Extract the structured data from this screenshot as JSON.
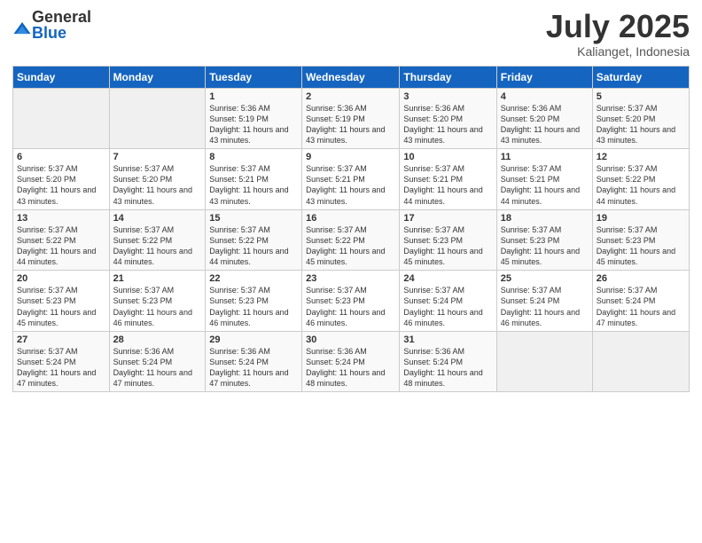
{
  "logo": {
    "general": "General",
    "blue": "Blue"
  },
  "title": "July 2025",
  "location": "Kalianget, Indonesia",
  "headers": [
    "Sunday",
    "Monday",
    "Tuesday",
    "Wednesday",
    "Thursday",
    "Friday",
    "Saturday"
  ],
  "weeks": [
    [
      {
        "day": "",
        "info": ""
      },
      {
        "day": "",
        "info": ""
      },
      {
        "day": "1",
        "info": "Sunrise: 5:36 AM\nSunset: 5:19 PM\nDaylight: 11 hours and 43 minutes."
      },
      {
        "day": "2",
        "info": "Sunrise: 5:36 AM\nSunset: 5:19 PM\nDaylight: 11 hours and 43 minutes."
      },
      {
        "day": "3",
        "info": "Sunrise: 5:36 AM\nSunset: 5:20 PM\nDaylight: 11 hours and 43 minutes."
      },
      {
        "day": "4",
        "info": "Sunrise: 5:36 AM\nSunset: 5:20 PM\nDaylight: 11 hours and 43 minutes."
      },
      {
        "day": "5",
        "info": "Sunrise: 5:37 AM\nSunset: 5:20 PM\nDaylight: 11 hours and 43 minutes."
      }
    ],
    [
      {
        "day": "6",
        "info": "Sunrise: 5:37 AM\nSunset: 5:20 PM\nDaylight: 11 hours and 43 minutes."
      },
      {
        "day": "7",
        "info": "Sunrise: 5:37 AM\nSunset: 5:20 PM\nDaylight: 11 hours and 43 minutes."
      },
      {
        "day": "8",
        "info": "Sunrise: 5:37 AM\nSunset: 5:21 PM\nDaylight: 11 hours and 43 minutes."
      },
      {
        "day": "9",
        "info": "Sunrise: 5:37 AM\nSunset: 5:21 PM\nDaylight: 11 hours and 43 minutes."
      },
      {
        "day": "10",
        "info": "Sunrise: 5:37 AM\nSunset: 5:21 PM\nDaylight: 11 hours and 44 minutes."
      },
      {
        "day": "11",
        "info": "Sunrise: 5:37 AM\nSunset: 5:21 PM\nDaylight: 11 hours and 44 minutes."
      },
      {
        "day": "12",
        "info": "Sunrise: 5:37 AM\nSunset: 5:22 PM\nDaylight: 11 hours and 44 minutes."
      }
    ],
    [
      {
        "day": "13",
        "info": "Sunrise: 5:37 AM\nSunset: 5:22 PM\nDaylight: 11 hours and 44 minutes."
      },
      {
        "day": "14",
        "info": "Sunrise: 5:37 AM\nSunset: 5:22 PM\nDaylight: 11 hours and 44 minutes."
      },
      {
        "day": "15",
        "info": "Sunrise: 5:37 AM\nSunset: 5:22 PM\nDaylight: 11 hours and 44 minutes."
      },
      {
        "day": "16",
        "info": "Sunrise: 5:37 AM\nSunset: 5:22 PM\nDaylight: 11 hours and 45 minutes."
      },
      {
        "day": "17",
        "info": "Sunrise: 5:37 AM\nSunset: 5:23 PM\nDaylight: 11 hours and 45 minutes."
      },
      {
        "day": "18",
        "info": "Sunrise: 5:37 AM\nSunset: 5:23 PM\nDaylight: 11 hours and 45 minutes."
      },
      {
        "day": "19",
        "info": "Sunrise: 5:37 AM\nSunset: 5:23 PM\nDaylight: 11 hours and 45 minutes."
      }
    ],
    [
      {
        "day": "20",
        "info": "Sunrise: 5:37 AM\nSunset: 5:23 PM\nDaylight: 11 hours and 45 minutes."
      },
      {
        "day": "21",
        "info": "Sunrise: 5:37 AM\nSunset: 5:23 PM\nDaylight: 11 hours and 46 minutes."
      },
      {
        "day": "22",
        "info": "Sunrise: 5:37 AM\nSunset: 5:23 PM\nDaylight: 11 hours and 46 minutes."
      },
      {
        "day": "23",
        "info": "Sunrise: 5:37 AM\nSunset: 5:23 PM\nDaylight: 11 hours and 46 minutes."
      },
      {
        "day": "24",
        "info": "Sunrise: 5:37 AM\nSunset: 5:24 PM\nDaylight: 11 hours and 46 minutes."
      },
      {
        "day": "25",
        "info": "Sunrise: 5:37 AM\nSunset: 5:24 PM\nDaylight: 11 hours and 46 minutes."
      },
      {
        "day": "26",
        "info": "Sunrise: 5:37 AM\nSunset: 5:24 PM\nDaylight: 11 hours and 47 minutes."
      }
    ],
    [
      {
        "day": "27",
        "info": "Sunrise: 5:37 AM\nSunset: 5:24 PM\nDaylight: 11 hours and 47 minutes."
      },
      {
        "day": "28",
        "info": "Sunrise: 5:36 AM\nSunset: 5:24 PM\nDaylight: 11 hours and 47 minutes."
      },
      {
        "day": "29",
        "info": "Sunrise: 5:36 AM\nSunset: 5:24 PM\nDaylight: 11 hours and 47 minutes."
      },
      {
        "day": "30",
        "info": "Sunrise: 5:36 AM\nSunset: 5:24 PM\nDaylight: 11 hours and 48 minutes."
      },
      {
        "day": "31",
        "info": "Sunrise: 5:36 AM\nSunset: 5:24 PM\nDaylight: 11 hours and 48 minutes."
      },
      {
        "day": "",
        "info": ""
      },
      {
        "day": "",
        "info": ""
      }
    ]
  ]
}
